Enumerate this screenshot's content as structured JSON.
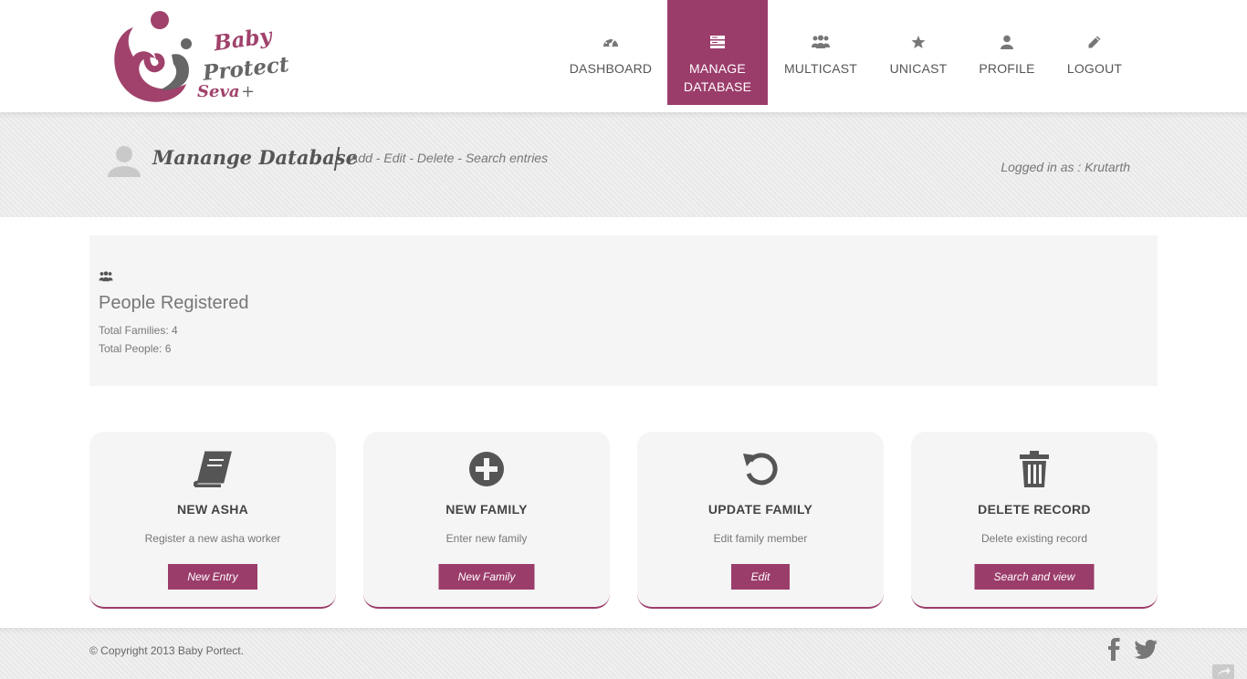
{
  "logo": {
    "line1": "Baby",
    "line2": "Protect",
    "line3": "Seva",
    "plus": "+"
  },
  "nav": {
    "items": [
      {
        "label": "DASHBOARD",
        "icon": "dashboard-icon",
        "active": false
      },
      {
        "label": "MANAGE\nDATABASE",
        "icon": "database-icon",
        "active": true
      },
      {
        "label": "MULTICAST",
        "icon": "group-icon",
        "active": false
      },
      {
        "label": "UNICAST",
        "icon": "star-icon",
        "active": false
      },
      {
        "label": "PROFILE",
        "icon": "user-icon",
        "active": false
      },
      {
        "label": "LOGOUT",
        "icon": "pencil-icon",
        "active": false
      }
    ]
  },
  "band": {
    "title": "Manange Database",
    "subtitle": "Add - Edit - Delete - Search entries",
    "logged_in": "Logged in as : Krutarth"
  },
  "stats": {
    "title": "People Registered",
    "families": "Total Families: 4",
    "people": "Total People: 6"
  },
  "cards": [
    {
      "title": "NEW ASHA",
      "desc": "Register a new asha worker",
      "button": "New Entry",
      "icon": "book-icon"
    },
    {
      "title": "NEW FAMILY",
      "desc": "Enter new family",
      "button": "New Family",
      "icon": "plus-circle-icon"
    },
    {
      "title": "UPDATE FAMILY",
      "desc": "Edit family member",
      "button": "Edit",
      "icon": "refresh-icon"
    },
    {
      "title": "DELETE RECORD",
      "desc": "Delete existing record",
      "button": "Search and view",
      "icon": "trash-icon"
    }
  ],
  "footer": {
    "copyright": "© Copyright 2013 Baby Portect."
  },
  "colors": {
    "accent": "#9b3d6b",
    "band_bg": "#ececec",
    "panel_bg": "#f5f5f5",
    "icon_gray": "#555555"
  }
}
